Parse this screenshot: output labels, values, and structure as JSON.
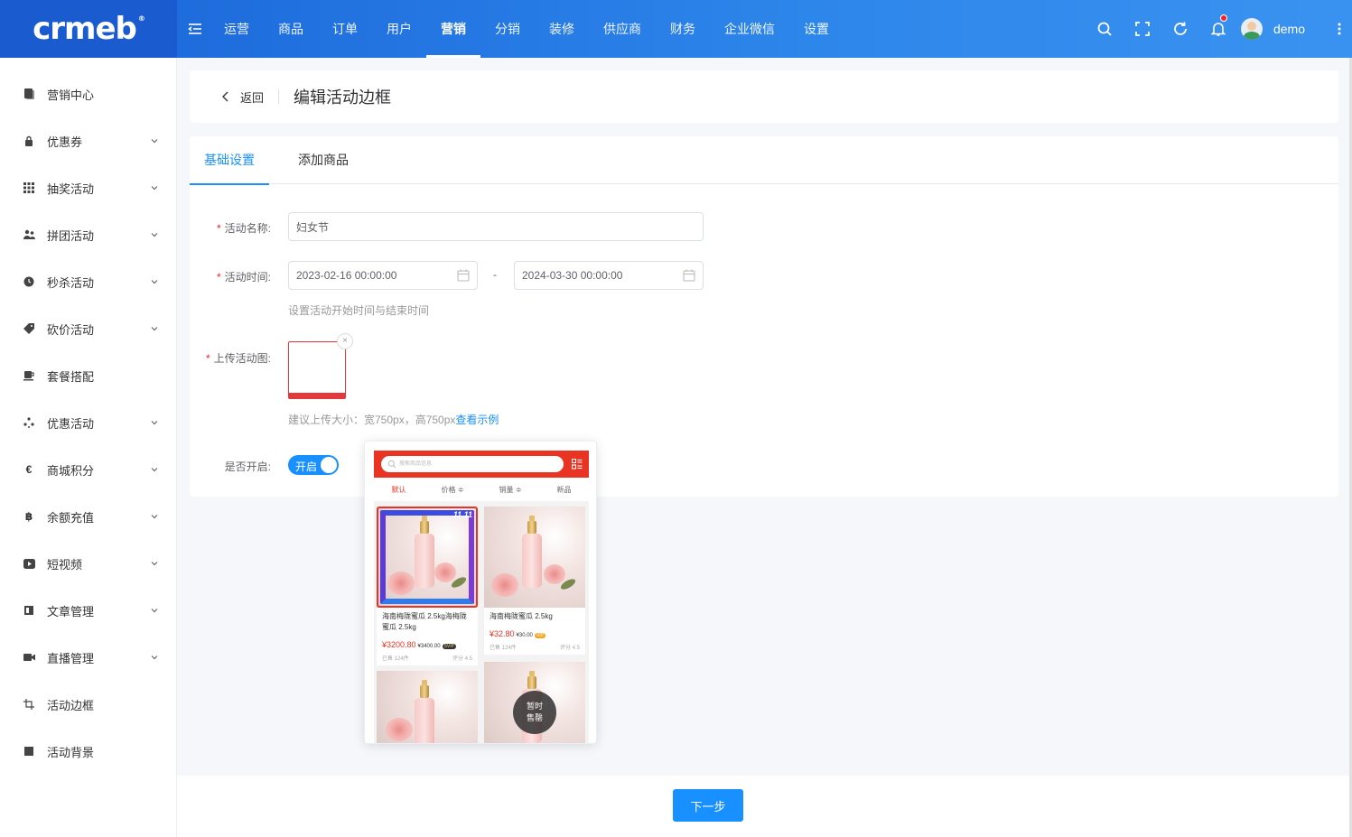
{
  "header": {
    "logo": "crmeb",
    "nav": [
      "运营",
      "商品",
      "订单",
      "用户",
      "营销",
      "分销",
      "装修",
      "供应商",
      "财务",
      "企业微信",
      "设置"
    ],
    "active_nav": "营销",
    "username": "demo",
    "accent": "#1890ff"
  },
  "sidebar": {
    "items": [
      {
        "label": "营销中心",
        "icon": "document-icon",
        "expandable": false
      },
      {
        "label": "优惠券",
        "icon": "lock-icon",
        "expandable": true
      },
      {
        "label": "抽奖活动",
        "icon": "grid-icon",
        "expandable": true
      },
      {
        "label": "拼团活动",
        "icon": "group-icon",
        "expandable": true
      },
      {
        "label": "秒杀活动",
        "icon": "clock-icon",
        "expandable": true
      },
      {
        "label": "砍价活动",
        "icon": "tag-icon",
        "expandable": true
      },
      {
        "label": "套餐搭配",
        "icon": "cup-icon",
        "expandable": false
      },
      {
        "label": "优惠活动",
        "icon": "discount-icon",
        "expandable": true
      },
      {
        "label": "商城积分",
        "icon": "euro-icon",
        "expandable": true
      },
      {
        "label": "余额充值",
        "icon": "baht-icon",
        "expandable": true
      },
      {
        "label": "短视频",
        "icon": "video-icon",
        "expandable": true
      },
      {
        "label": "文章管理",
        "icon": "article-icon",
        "expandable": true
      },
      {
        "label": "直播管理",
        "icon": "camera-icon",
        "expandable": true
      },
      {
        "label": "活动边框",
        "icon": "crop-icon",
        "expandable": false
      },
      {
        "label": "活动背景",
        "icon": "square-icon",
        "expandable": false
      }
    ]
  },
  "page": {
    "back_label": "返回",
    "title": "编辑活动边框"
  },
  "tabs": [
    "基础设置",
    "添加商品"
  ],
  "form": {
    "name_label": "活动名称:",
    "name_value": "妇女节",
    "time_label": "活动时间:",
    "start_time": "2023-02-16 00:00:00",
    "end_time": "2024-03-30 00:00:00",
    "time_separator": "-",
    "time_tip": "设置活动开始时间与结束时间",
    "upload_label": "上传活动图:",
    "upload_close": "×",
    "upload_tip": "建议上传大小：宽750px，高750px",
    "upload_example_link": "查看示例",
    "enable_label": "是否开启:",
    "enable_text": "开启",
    "next_button": "下一步"
  },
  "example": {
    "search_placeholder": "搜索商品信息",
    "sort_tabs": [
      "默认",
      "价格 ≑",
      "销量 ≑",
      "新品"
    ],
    "badge": "11.11",
    "products": [
      {
        "name": "海南梅陇蜜瓜 2.5kg海梅陇蜜瓜 2.5kg",
        "price": "¥3200.80",
        "old_price": "¥3400.00",
        "vip": "SVIP",
        "sold": "已售 124件",
        "score": "评分 4.5"
      },
      {
        "name": "海南梅陇蜜瓜 2.5kg",
        "price": "¥32.80",
        "old_price": "¥30.00",
        "vip": "VIP",
        "sold": "已售 124件",
        "score": "评分 4.5"
      }
    ],
    "sold_out_line1": "暂时",
    "sold_out_line2": "售罄"
  }
}
